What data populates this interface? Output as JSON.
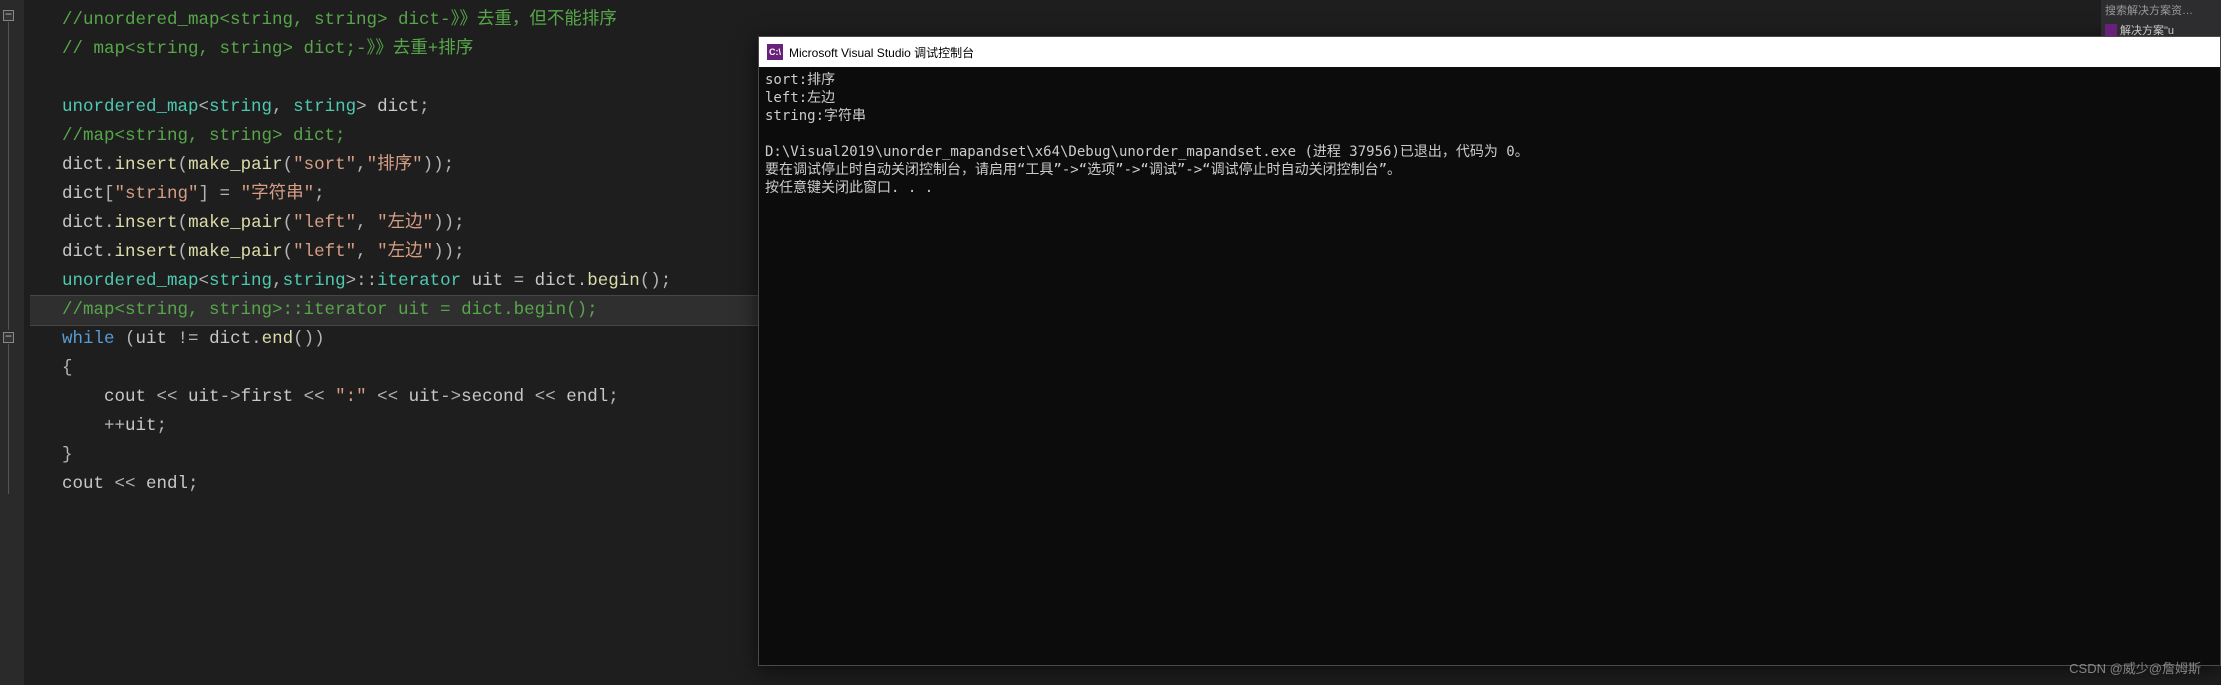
{
  "editor": {
    "lines": [
      {
        "type": "comment",
        "text": "//unordered_map<string, string> dict-》》去重，但不能排序"
      },
      {
        "type": "comment",
        "text": "// map<string, string> dict;-》》去重+排序"
      },
      {
        "type": "blank",
        "text": ""
      },
      {
        "type": "code",
        "tokens": [
          [
            "type",
            "unordered_map"
          ],
          [
            "angle",
            "<"
          ],
          [
            "type",
            "string"
          ],
          [
            "punct",
            ", "
          ],
          [
            "type",
            "string"
          ],
          [
            "angle",
            ">"
          ],
          [
            "ident",
            " dict"
          ],
          [
            "punct",
            ";"
          ]
        ]
      },
      {
        "type": "comment",
        "text": "//map<string, string> dict;"
      },
      {
        "type": "code",
        "tokens": [
          [
            "ident",
            "dict"
          ],
          [
            "punct",
            "."
          ],
          [
            "func",
            "insert"
          ],
          [
            "punct",
            "("
          ],
          [
            "func",
            "make_pair"
          ],
          [
            "punct",
            "("
          ],
          [
            "string",
            "\"sort\""
          ],
          [
            "punct",
            ","
          ],
          [
            "string",
            "\"排序\""
          ],
          [
            "punct",
            "));"
          ]
        ]
      },
      {
        "type": "code",
        "tokens": [
          [
            "ident",
            "dict"
          ],
          [
            "punct",
            "["
          ],
          [
            "string",
            "\"string\""
          ],
          [
            "punct",
            "] = "
          ],
          [
            "string",
            "\"字符串\""
          ],
          [
            "punct",
            ";"
          ]
        ]
      },
      {
        "type": "code",
        "tokens": [
          [
            "ident",
            "dict"
          ],
          [
            "punct",
            "."
          ],
          [
            "func",
            "insert"
          ],
          [
            "punct",
            "("
          ],
          [
            "func",
            "make_pair"
          ],
          [
            "punct",
            "("
          ],
          [
            "string",
            "\"left\""
          ],
          [
            "punct",
            ", "
          ],
          [
            "string",
            "\"左边\""
          ],
          [
            "punct",
            "));"
          ]
        ]
      },
      {
        "type": "code",
        "tokens": [
          [
            "ident",
            "dict"
          ],
          [
            "punct",
            "."
          ],
          [
            "func",
            "insert"
          ],
          [
            "punct",
            "("
          ],
          [
            "func",
            "make_pair"
          ],
          [
            "punct",
            "("
          ],
          [
            "string",
            "\"left\""
          ],
          [
            "punct",
            ", "
          ],
          [
            "string",
            "\"左边\""
          ],
          [
            "punct",
            "));"
          ]
        ]
      },
      {
        "type": "code",
        "tokens": [
          [
            "type",
            "unordered_map"
          ],
          [
            "angle",
            "<"
          ],
          [
            "type",
            "string"
          ],
          [
            "punct",
            ","
          ],
          [
            "type",
            "string"
          ],
          [
            "angle",
            ">"
          ],
          [
            "punct",
            "::"
          ],
          [
            "type",
            "iterator"
          ],
          [
            "ident",
            " uit"
          ],
          [
            "punct",
            " = "
          ],
          [
            "ident",
            "dict"
          ],
          [
            "punct",
            "."
          ],
          [
            "func",
            "begin"
          ],
          [
            "punct",
            "();"
          ]
        ]
      },
      {
        "type": "comment",
        "text": "//map<string, string>::iterator uit = dict.begin();",
        "active": true
      },
      {
        "type": "code",
        "tokens": [
          [
            "keyword",
            "while"
          ],
          [
            "punct",
            " ("
          ],
          [
            "ident",
            "uit"
          ],
          [
            "punct",
            " != "
          ],
          [
            "ident",
            "dict"
          ],
          [
            "punct",
            "."
          ],
          [
            "func",
            "end"
          ],
          [
            "punct",
            "())"
          ]
        ]
      },
      {
        "type": "code",
        "tokens": [
          [
            "punct",
            "{"
          ]
        ]
      },
      {
        "type": "code",
        "indent": 1,
        "tokens": [
          [
            "ident",
            "cout"
          ],
          [
            "punct",
            " << "
          ],
          [
            "ident",
            "uit"
          ],
          [
            "punct",
            "->"
          ],
          [
            "ident",
            "first"
          ],
          [
            "punct",
            " << "
          ],
          [
            "string",
            "\":\""
          ],
          [
            "punct",
            " << "
          ],
          [
            "ident",
            "uit"
          ],
          [
            "punct",
            "->"
          ],
          [
            "ident",
            "second"
          ],
          [
            "punct",
            " << "
          ],
          [
            "ident",
            "endl"
          ],
          [
            "punct",
            ";"
          ]
        ]
      },
      {
        "type": "code",
        "indent": 1,
        "tokens": [
          [
            "punct",
            "++"
          ],
          [
            "ident",
            "uit"
          ],
          [
            "punct",
            ";"
          ]
        ]
      },
      {
        "type": "code",
        "tokens": [
          [
            "punct",
            "}"
          ]
        ]
      },
      {
        "type": "code",
        "tokens": [
          [
            "ident",
            "cout"
          ],
          [
            "punct",
            " << "
          ],
          [
            "ident",
            "endl"
          ],
          [
            "punct",
            ";"
          ]
        ]
      }
    ]
  },
  "console": {
    "icon_label": "C:\\",
    "title": "Microsoft Visual Studio 调试控制台",
    "output": "sort:排序\nleft:左边\nstring:字符串\n\nD:\\Visual2019\\unorder_mapandset\\x64\\Debug\\unorder_mapandset.exe (进程 37956)已退出，代码为 0。\n要在调试停止时自动关闭控制台，请启用“工具”->“选项”->“调试”->“调试停止时自动关闭控制台”。\n按任意键关闭此窗口. . ."
  },
  "right_panel": {
    "search_placeholder": "搜索解决方案资…",
    "solution_label": "解决方案\"u"
  },
  "watermark": "CSDN @威少@詹姆斯"
}
